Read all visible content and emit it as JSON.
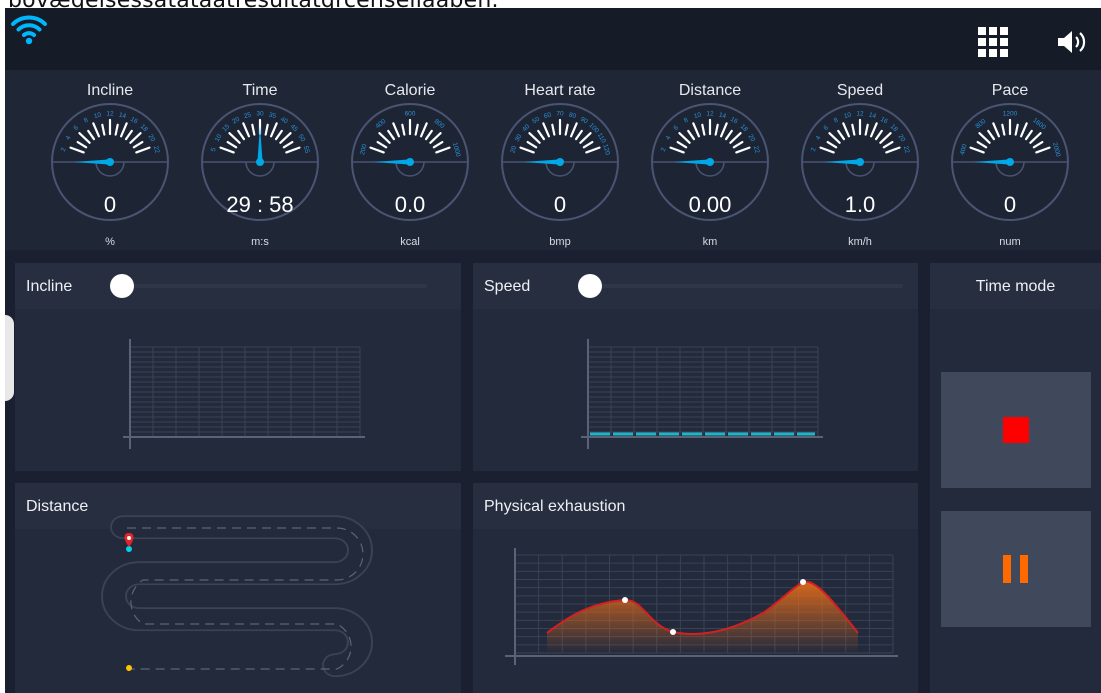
{
  "overlay_text": "bovæqelsessatataatresuitatqrcenseliaaben.",
  "topbar": {
    "wifi_icon": "wifi-icon",
    "apps_icon": "grid-icon",
    "sound_icon": "volume-icon"
  },
  "gauges": [
    {
      "title": "Incline",
      "value": "0",
      "unit": "%",
      "ticks": [
        "2",
        "4",
        "6",
        "8",
        "10",
        "12",
        "14",
        "16",
        "18",
        "20",
        "22"
      ],
      "needle": 0
    },
    {
      "title": "Time",
      "value": "29 : 58",
      "unit": "m:s",
      "ticks": [
        "5",
        "10",
        "15",
        "20",
        "25",
        "30",
        "35",
        "40",
        "45",
        "50",
        "55"
      ],
      "needle": 0.5
    },
    {
      "title": "Calorie",
      "value": "0.0",
      "unit": "kcal",
      "ticks": [
        "200",
        "400",
        "600",
        "800",
        "1000"
      ],
      "needle": 0
    },
    {
      "title": "Heart rate",
      "value": "0",
      "unit": "bmp",
      "ticks": [
        "20",
        "30",
        "40",
        "50",
        "60",
        "70",
        "80",
        "90",
        "100",
        "110",
        "120"
      ],
      "needle": 0
    },
    {
      "title": "Distance",
      "value": "0.00",
      "unit": "km",
      "ticks": [
        "2",
        "4",
        "6",
        "8",
        "10",
        "12",
        "14",
        "16",
        "18",
        "20",
        "22"
      ],
      "needle": 0
    },
    {
      "title": "Speed",
      "value": "1.0",
      "unit": "km/h",
      "ticks": [
        "2",
        "4",
        "6",
        "8",
        "10",
        "12",
        "14",
        "16",
        "18",
        "20",
        "22"
      ],
      "needle": 0
    },
    {
      "title": "Pace",
      "value": "0",
      "unit": "num",
      "ticks": [
        "400",
        "800",
        "1200",
        "1600",
        "2000"
      ],
      "needle": 0
    }
  ],
  "incline_panel": {
    "title": "Incline",
    "slider_value": 0
  },
  "speed_panel": {
    "title": "Speed",
    "slider_value": 0
  },
  "mode_panel": {
    "title": "Time mode",
    "stop_icon": "stop-icon",
    "pause_icon": "pause-icon",
    "stop_color": "#ff0000",
    "pause_color": "#ff6a00"
  },
  "distance_panel": {
    "title": "Distance",
    "start_icon": "location-pin-icon"
  },
  "exhaustion_panel": {
    "title": "Physical exhaustion"
  },
  "colors": {
    "accent": "#00a8e8",
    "speed_line": "#1fb5c8",
    "curve": "#d42020"
  }
}
